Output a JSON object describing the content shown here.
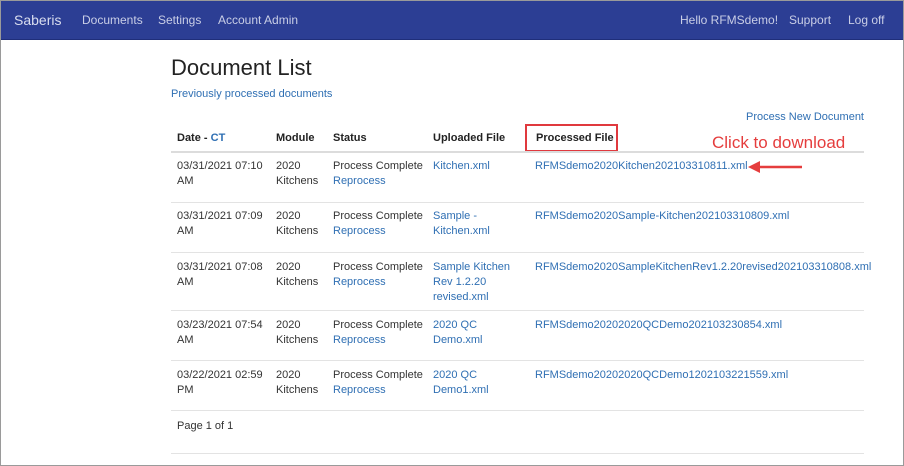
{
  "nav": {
    "brand": "Saberis",
    "items": [
      "Documents",
      "Settings",
      "Account Admin"
    ],
    "greeting": "Hello RFMSdemo!",
    "support": "Support",
    "logoff": "Log off"
  },
  "page": {
    "title": "Document List",
    "subtitle_link": "Previously processed documents",
    "new_doc_link": "Process New Document"
  },
  "table": {
    "headers": {
      "date": "Date - ",
      "date_tz": "CT",
      "module": "Module",
      "status": "Status",
      "uploaded": "Uploaded File",
      "processed": "Processed File"
    },
    "rows": [
      {
        "date": "03/31/2021 07:10 AM",
        "module": "2020 Kitchens",
        "status": "Process Complete",
        "reprocess": "Reprocess",
        "uploaded": "Kitchen.xml",
        "processed": "RFMSdemo2020Kitchen202103310811.xml"
      },
      {
        "date": "03/31/2021 07:09 AM",
        "module": "2020 Kitchens",
        "status": "Process Complete",
        "reprocess": "Reprocess",
        "uploaded": "Sample - Kitchen.xml",
        "processed": "RFMSdemo2020Sample-Kitchen202103310809.xml"
      },
      {
        "date": "03/31/2021 07:08 AM",
        "module": "2020 Kitchens",
        "status": "Process Complete",
        "reprocess": "Reprocess",
        "uploaded": "Sample Kitchen Rev 1.2.20 revised.xml",
        "processed": "RFMSdemo2020SampleKitchenRev1.2.20revised202103310808.xml"
      },
      {
        "date": "03/23/2021 07:54 AM",
        "module": "2020 Kitchens",
        "status": "Process Complete",
        "reprocess": "Reprocess",
        "uploaded": "2020 QC Demo.xml",
        "processed": "RFMSdemo20202020QCDemo202103230854.xml"
      },
      {
        "date": "03/22/2021 02:59 PM",
        "module": "2020 Kitchens",
        "status": "Process Complete",
        "reprocess": "Reprocess",
        "uploaded": "2020 QC Demo1.xml",
        "processed": "RFMSdemo20202020QCDemo1202103221559.xml"
      }
    ],
    "pager": "Page 1 of 1"
  },
  "annotation": {
    "text": "Click to download",
    "color": "#e53d3d"
  },
  "colors": {
    "navbar": "#2c3e94",
    "link": "#2f6fb3"
  }
}
